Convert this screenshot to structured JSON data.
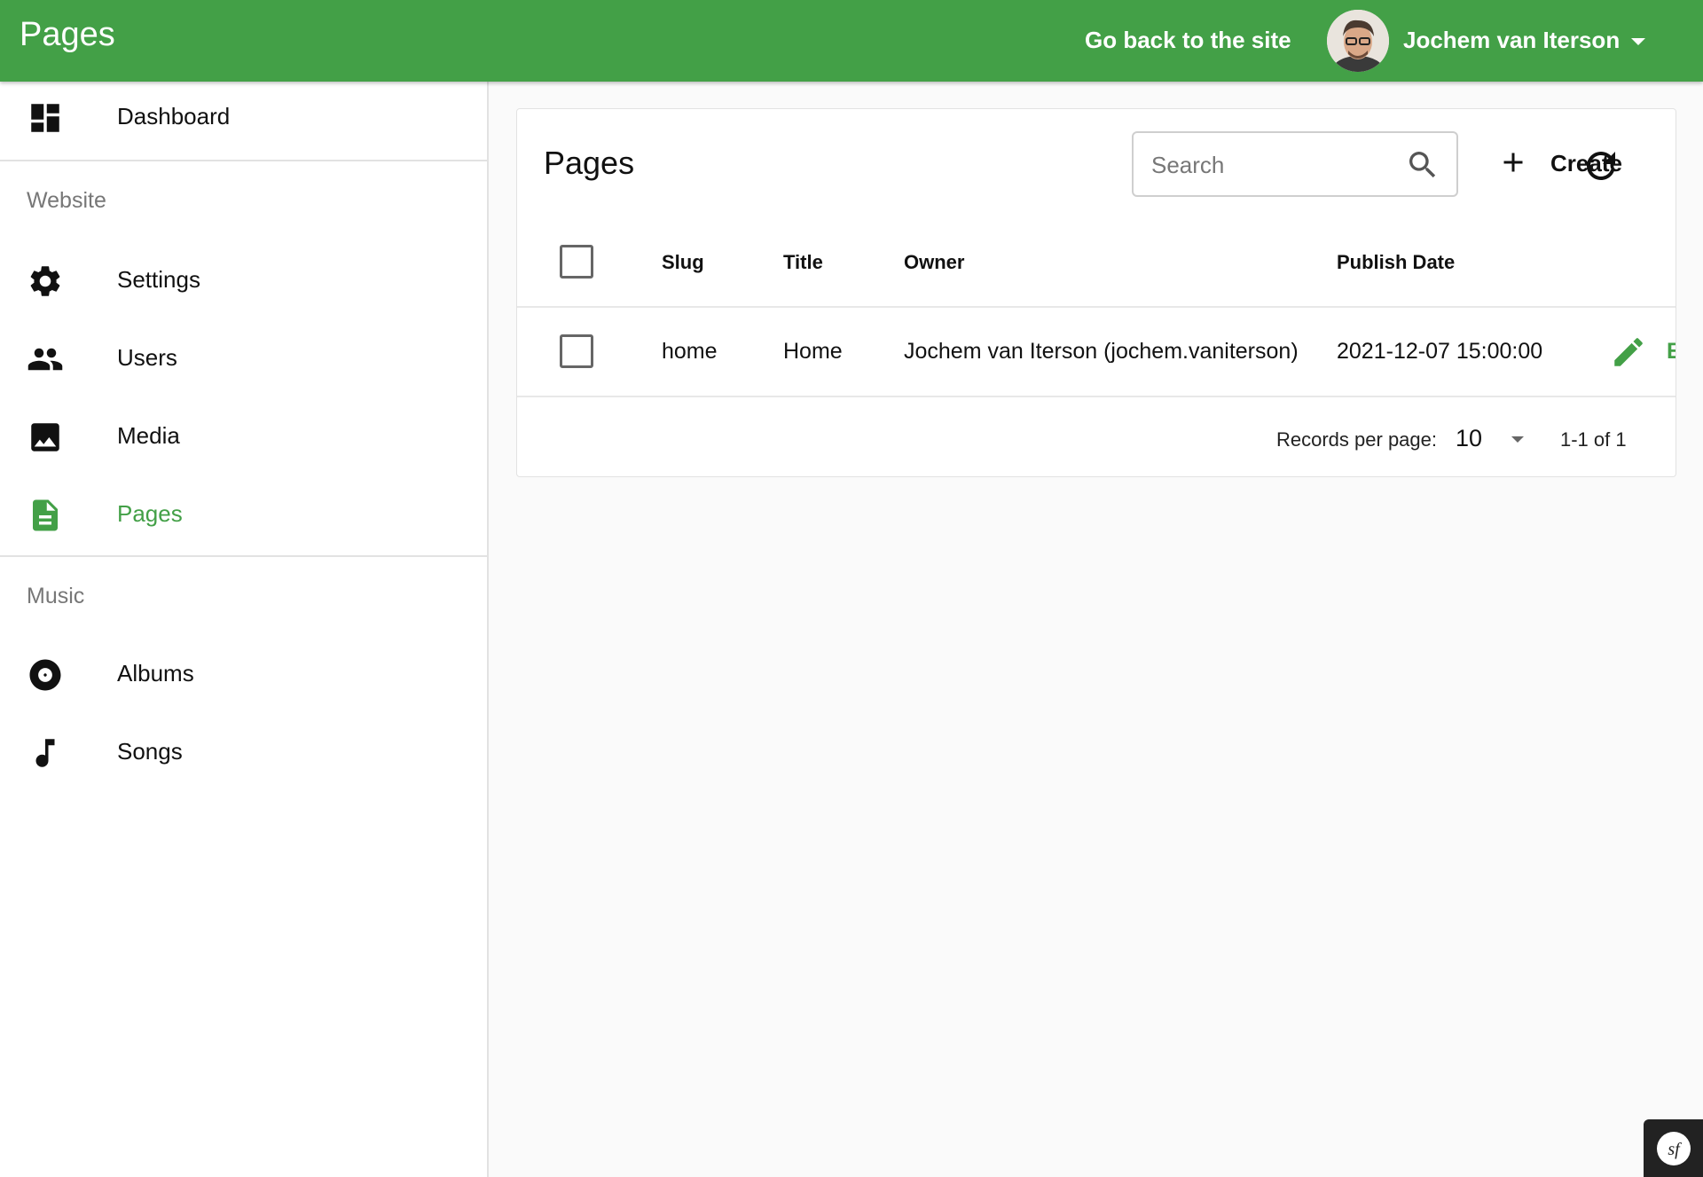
{
  "appbar": {
    "title": "Pages",
    "back_link": "Go back to the site",
    "user_name": "Jochem van Iterson"
  },
  "sidebar": {
    "dashboard": "Dashboard",
    "sections": [
      {
        "title": "Website",
        "items": [
          {
            "label": "Settings",
            "icon": "gear-icon"
          },
          {
            "label": "Users",
            "icon": "people-icon"
          },
          {
            "label": "Media",
            "icon": "image-icon"
          },
          {
            "label": "Pages",
            "icon": "document-icon",
            "active": true
          }
        ]
      },
      {
        "title": "Music",
        "items": [
          {
            "label": "Albums",
            "icon": "disc-icon"
          },
          {
            "label": "Songs",
            "icon": "music-note-icon"
          }
        ]
      }
    ]
  },
  "card": {
    "title": "Pages",
    "search_placeholder": "Search",
    "create_label": "Create"
  },
  "table": {
    "columns": [
      "Slug",
      "Title",
      "Owner",
      "Publish Date"
    ],
    "rows": [
      {
        "slug": "home",
        "title": "Home",
        "owner": "Jochem van Iterson (jochem.vaniterson)",
        "publish_date": "2021-12-07 15:00:00",
        "action_label": "E"
      }
    ]
  },
  "pagination": {
    "records_per_page_label": "Records per page:",
    "records_per_page": "10",
    "range": "1-1 of 1"
  },
  "colors": {
    "accent": "#43a047"
  }
}
